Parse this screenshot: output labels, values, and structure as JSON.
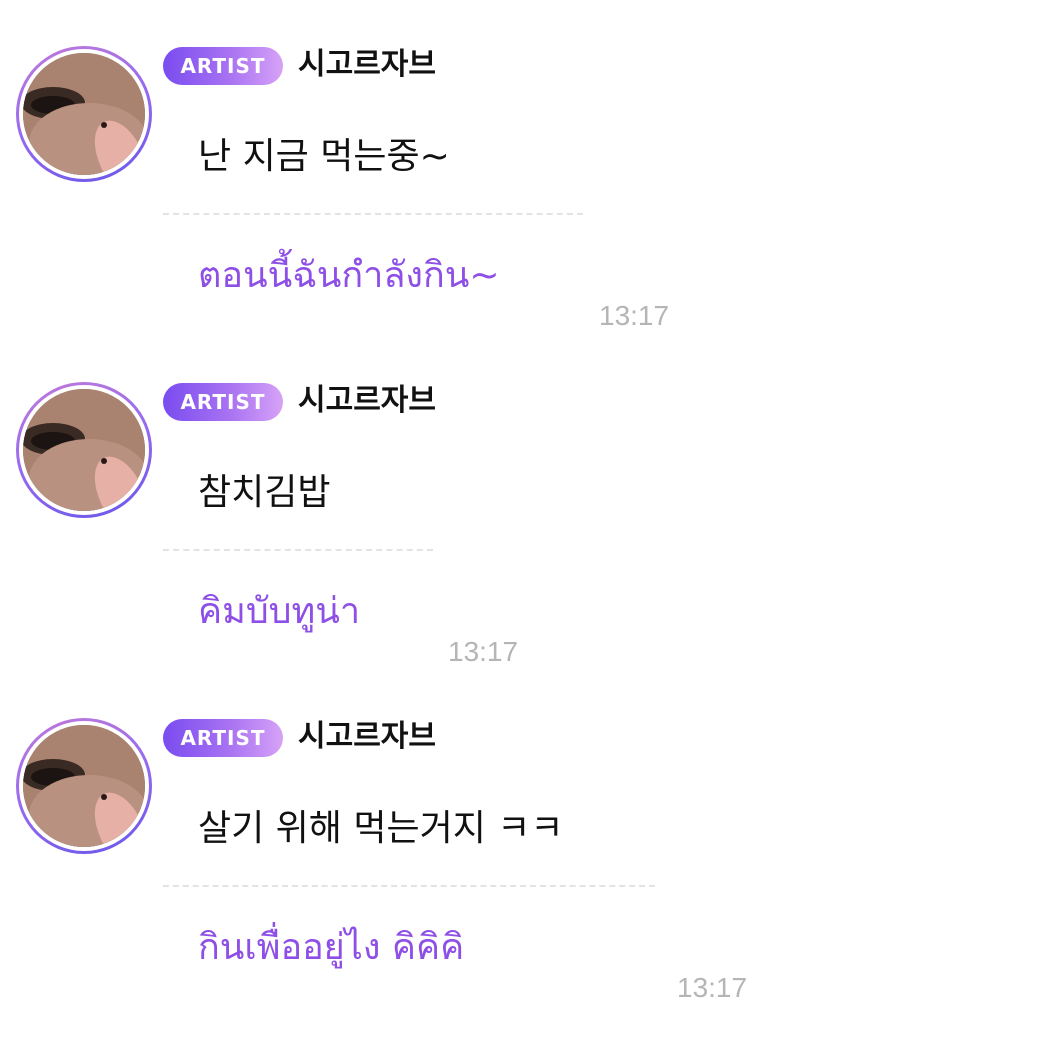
{
  "messages": [
    {
      "badge": "ARTIST",
      "author": "시고르자브",
      "text": "난 지금 먹는중~",
      "translation": "ตอนนี้ฉันกำลังกิน~",
      "time": "13:17"
    },
    {
      "badge": "ARTIST",
      "author": "시고르자브",
      "text": "참치김밥",
      "translation": "คิมบับทูน่า",
      "time": "13:17"
    },
    {
      "badge": "ARTIST",
      "author": "시고르자브",
      "text": "살기 위해 먹는거지 ㅋㅋ",
      "translation": "กินเพื่ออยู่ไง คิคิคิ",
      "time": "13:17"
    }
  ],
  "colors": {
    "translation": "#8e4fe6",
    "badge_start": "#7a4cf0",
    "badge_end": "#d6a2f7",
    "timestamp": "#b5b5b5"
  }
}
